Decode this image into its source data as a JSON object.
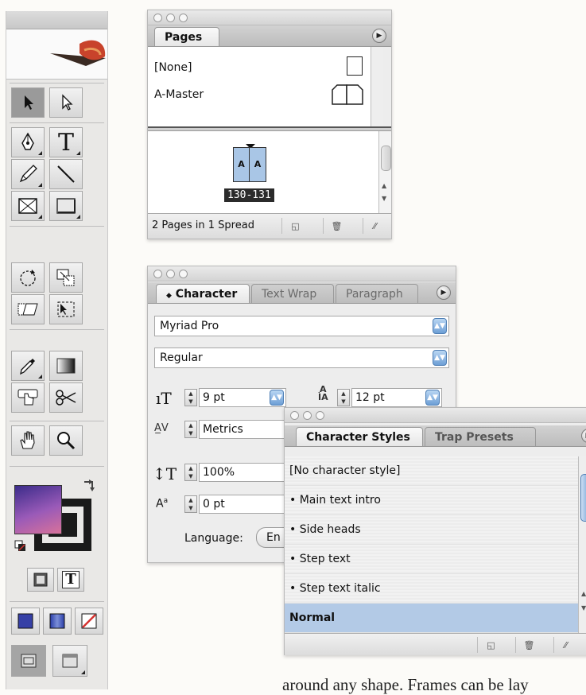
{
  "pages_panel": {
    "tab": "Pages",
    "masters": [
      {
        "label": "[None]"
      },
      {
        "label": "A-Master"
      }
    ],
    "spread": {
      "left_page": "A",
      "right_page": "A",
      "range": "130-131"
    },
    "status": "2 Pages in 1 Spread"
  },
  "character_panel": {
    "tabs": {
      "active": "Character",
      "second": "Text Wrap",
      "third": "Paragraph"
    },
    "tab_glyph": "◆",
    "font_family": "Myriad Pro",
    "font_style": "Regular",
    "size": "9 pt",
    "leading": "12 pt",
    "kerning": "Metrics",
    "vertical_scale": "100%",
    "baseline_shift": "0 pt",
    "language_label": "Language:",
    "language_value": "En"
  },
  "char_styles_panel": {
    "tabs": {
      "active": "Character Styles",
      "second": "Trap Presets"
    },
    "items": [
      {
        "label": "[No character style]"
      },
      {
        "label": "• Main text intro"
      },
      {
        "label": "• Side heads"
      },
      {
        "label": "• Step text"
      },
      {
        "label": "• Step text italic"
      },
      {
        "label": "Normal"
      }
    ]
  },
  "toolbox": {
    "type_tool_glyph": "T",
    "formatting_text_glyph": "T"
  },
  "colors": {
    "selection": "#b3cae6",
    "accent_blue": "#6e9fd6",
    "none_swatch": "#d6322f"
  },
  "body_text": "around any shape. Frames can be lay"
}
